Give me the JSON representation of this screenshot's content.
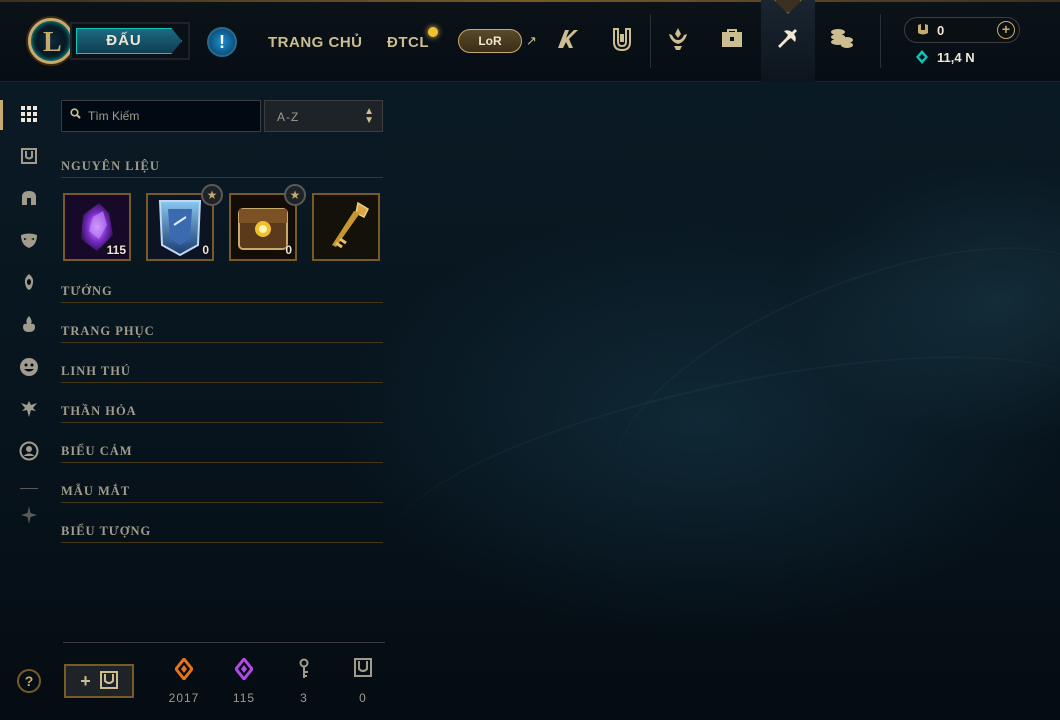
{
  "topbar": {
    "logo_letter": "L",
    "play_label": "ĐẤU",
    "alert_label": "!",
    "nav_home": "TRANG CHỦ",
    "nav_tft": "ĐTCL",
    "lor_label": "LoR",
    "external_arrow": "↗",
    "icons": [
      "profile-icon",
      "collection-icon",
      "ranked-icon",
      "inventory-icon",
      "loot-icon",
      "store-icon"
    ],
    "rp_amount": "0",
    "add_rp": "+",
    "be_amount": "11,4 N"
  },
  "sidebar": {
    "icons": [
      "grid-icon",
      "chest-icon",
      "helmet-icon",
      "mask-icon",
      "ward-icon",
      "flame-icon",
      "emote-face-icon",
      "champion-icon",
      "profile-circle-icon",
      "spike-icon"
    ],
    "help_label": "?"
  },
  "search": {
    "placeholder": "Tìm Kiếm",
    "sort_value": "A-Z"
  },
  "sections": {
    "materials": "NGUYÊN LIỆU",
    "champions": "TƯỚNG",
    "skins": "TRANG PHỤC",
    "pets": "LINH THÚ",
    "wards": "THẦN HỎA",
    "emotes": "BIỂU CẢM",
    "eye_colors": "MẪU MẮT",
    "icons": "BIỂU TƯỢNG"
  },
  "materials_items": [
    {
      "name": "mythic-essence",
      "count": "115"
    },
    {
      "name": "hextech-chest",
      "count": "0"
    },
    {
      "name": "masterwork-chest",
      "count": "0"
    },
    {
      "name": "hextech-key",
      "count": ""
    }
  ],
  "bottom": {
    "craft_label": "+",
    "materials": [
      {
        "icon": "orange-essence-icon",
        "value": "2017"
      },
      {
        "icon": "mythic-essence-icon",
        "value": "115"
      },
      {
        "icon": "key-fragment-icon",
        "value": "3"
      },
      {
        "icon": "chest-icon",
        "value": "0"
      }
    ]
  },
  "colors": {
    "gold": "#c8aa6e",
    "gold_dark": "#785a28",
    "teal": "#0ac8b9",
    "text": "#a09b8c",
    "text_light": "#f0e6d2"
  }
}
